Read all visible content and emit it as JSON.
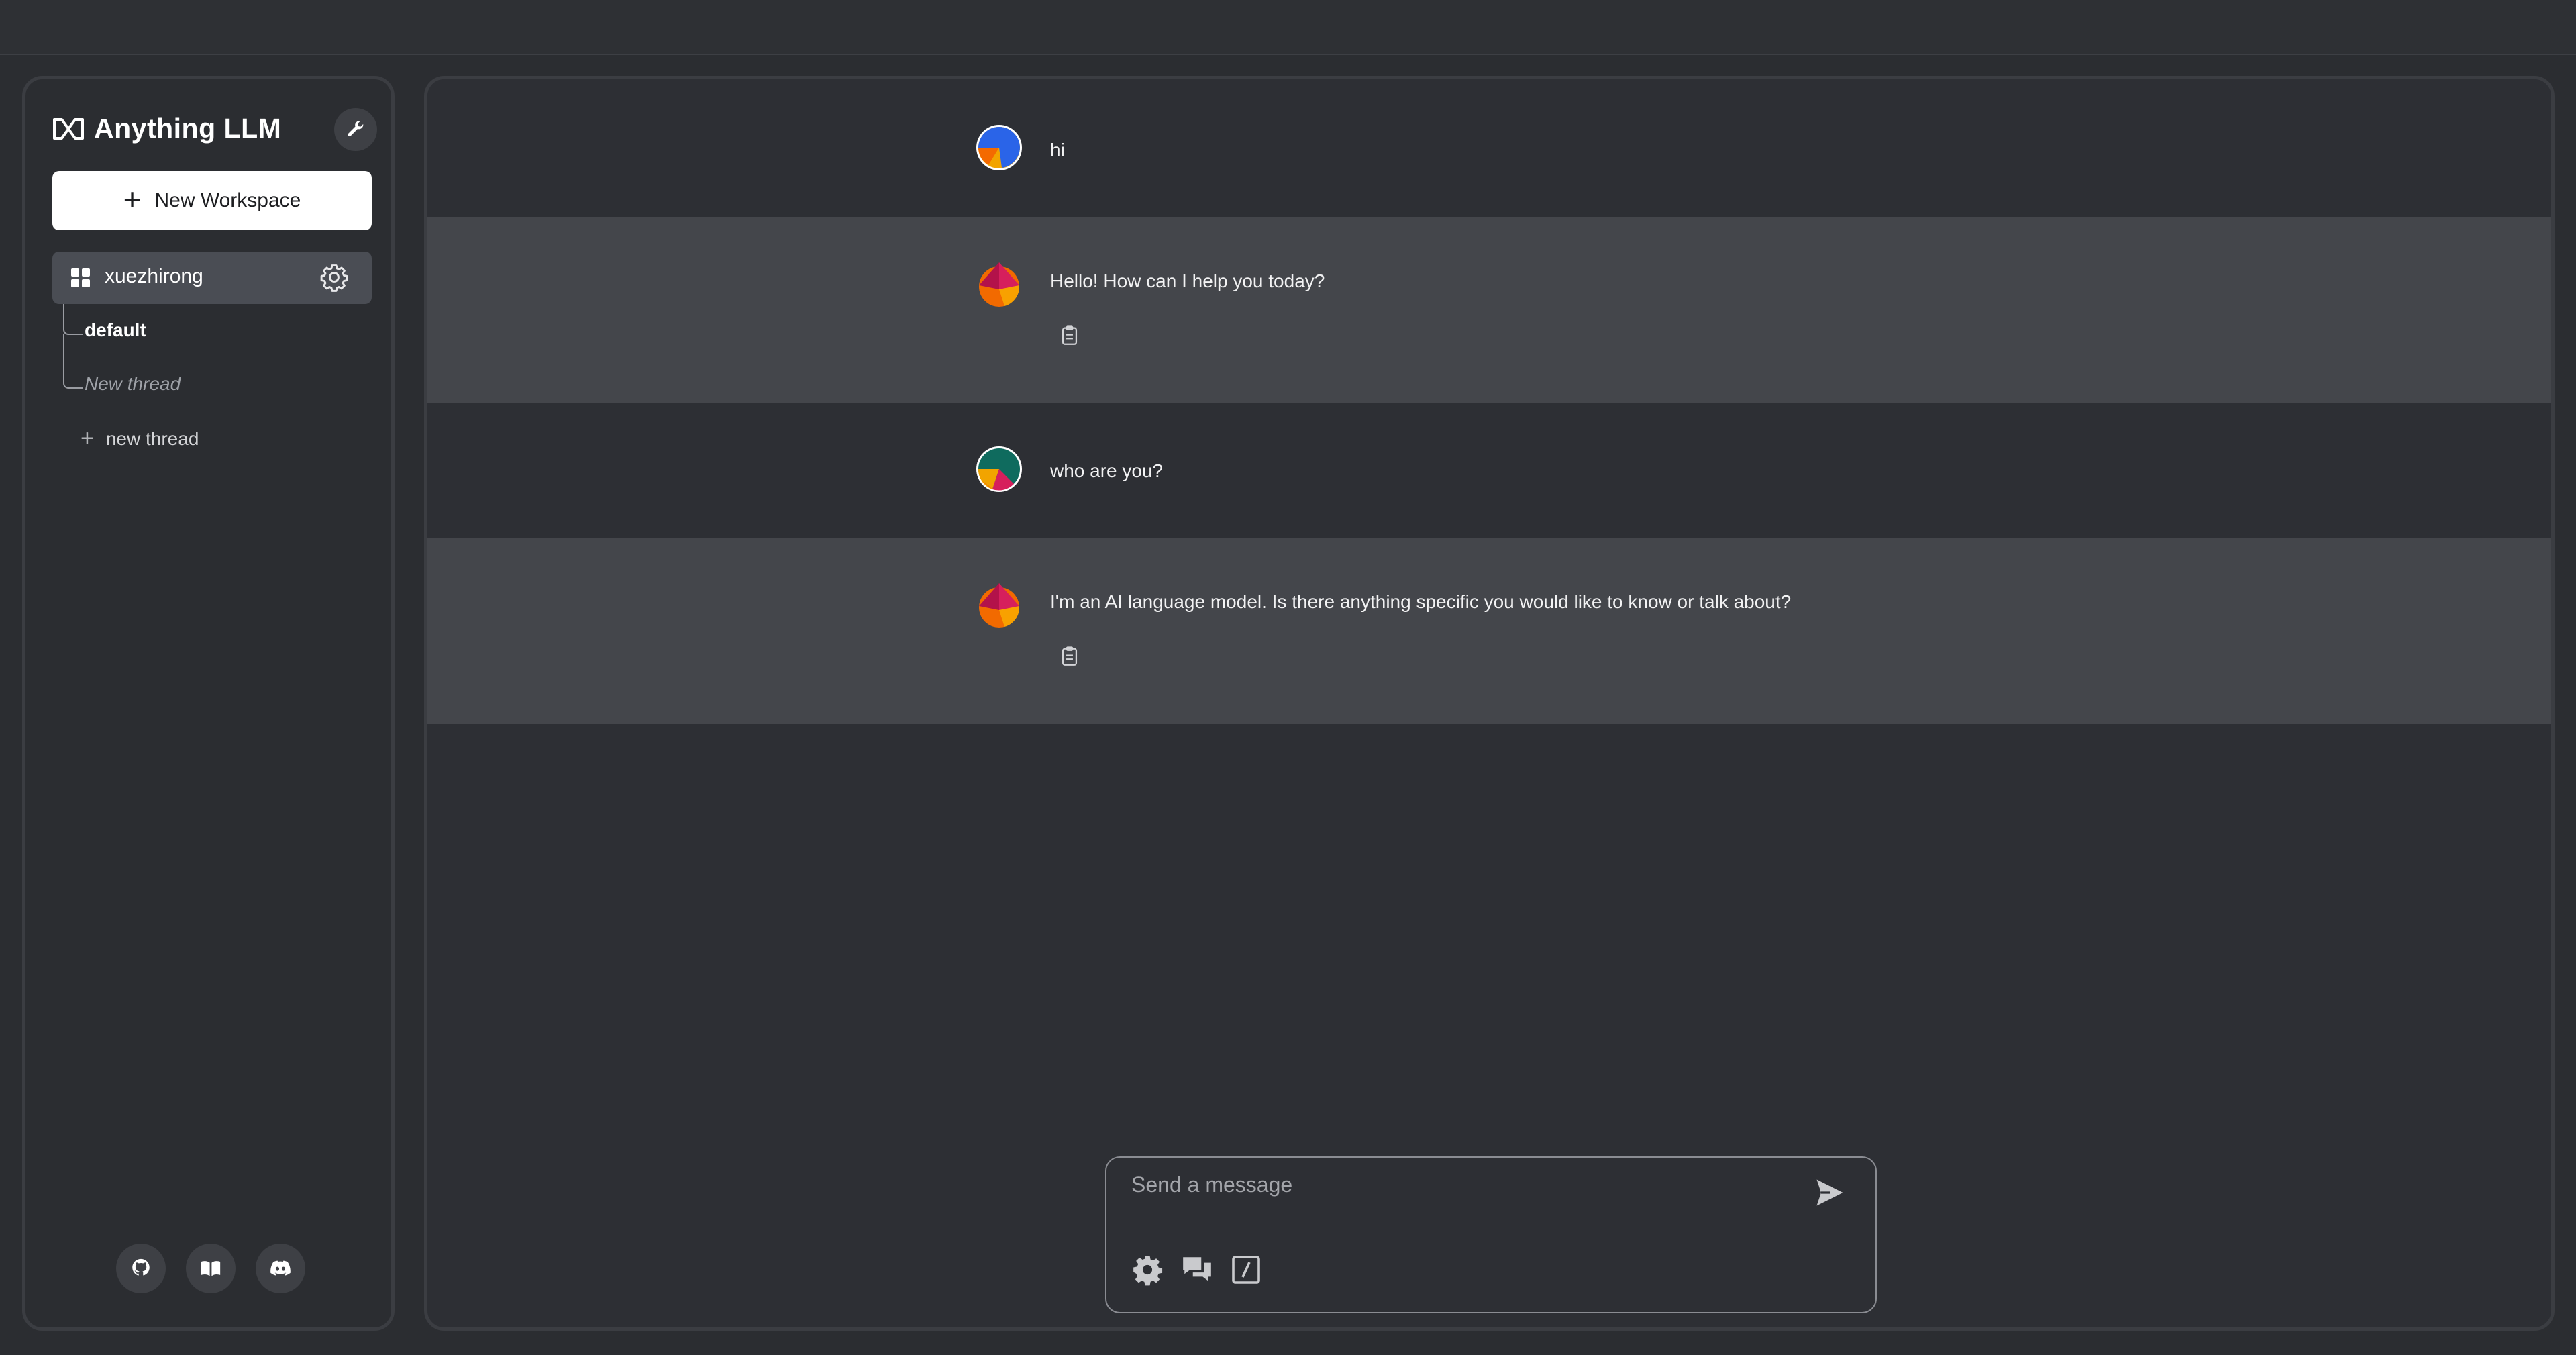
{
  "app": {
    "title": "Anything LLM"
  },
  "sidebar": {
    "new_workspace_label": "New Workspace",
    "workspace": {
      "name": "xuezhirong"
    },
    "threads": [
      {
        "label": "default"
      },
      {
        "label": "New thread"
      }
    ],
    "new_thread_label": "new thread",
    "footer_icons": [
      "github-icon",
      "docs-book-icon",
      "discord-icon"
    ]
  },
  "chat": {
    "messages": [
      {
        "role": "user",
        "text": "hi"
      },
      {
        "role": "assistant",
        "text": "Hello! How can I help you today?"
      },
      {
        "role": "user",
        "text": "who are you?"
      },
      {
        "role": "assistant",
        "text": "I'm an AI language model. Is there anything specific you would like to know or talk about?"
      }
    ]
  },
  "input": {
    "placeholder": "Send a message",
    "tools": [
      "settings-gear-icon",
      "chat-bubbles-icon",
      "slash-command-icon"
    ]
  },
  "colors": {
    "background": "#2b2d31",
    "assistant_row": "#44464b",
    "workspace_active": "#4a4d54"
  }
}
